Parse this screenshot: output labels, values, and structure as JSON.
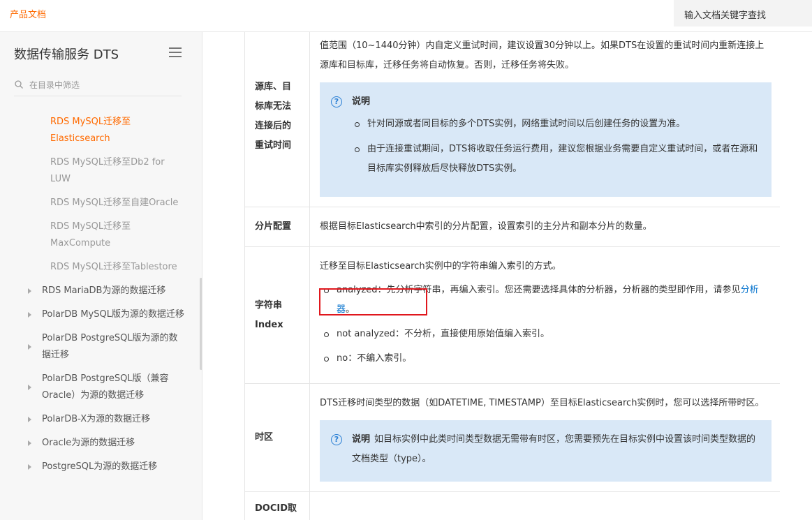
{
  "topbar": {
    "brand": "产品文档",
    "search_placeholder": "输入文档关键字查找"
  },
  "sidebar": {
    "title": "数据传输服务 DTS",
    "filter_placeholder": "在目录中筛选",
    "items": [
      {
        "label": "RDS MySQL迁移至Elasticsearch"
      },
      {
        "label": "RDS MySQL迁移至Db2 for LUW"
      },
      {
        "label": "RDS MySQL迁移至自建Oracle"
      },
      {
        "label": "RDS MySQL迁移至MaxCompute"
      },
      {
        "label": "RDS MySQL迁移至Tablestore"
      },
      {
        "label": "RDS MariaDB为源的数据迁移"
      },
      {
        "label": "PolarDB MySQL版为源的数据迁移"
      },
      {
        "label": "PolarDB PostgreSQL版为源的数据迁移"
      },
      {
        "label": "PolarDB PostgreSQL版（兼容Oracle）为源的数据迁移"
      },
      {
        "label": "PolarDB-X为源的数据迁移"
      },
      {
        "label": "Oracle为源的数据迁移"
      },
      {
        "label": "PostgreSQL为源的数据迁移"
      }
    ]
  },
  "content": {
    "rows": [
      {
        "name": "源库、目标库无法连接后的重试时间",
        "desc": "值范围（10~1440分钟）内自定义重试时间，建议设置30分钟以上。如果DTS在设置的重试时间内重新连接上源库和目标库，迁移任务将自动恢复。否则，迁移任务将失败。",
        "note_title": "说明",
        "note_items": [
          "针对同源或者同目标的多个DTS实例，网络重试时间以后创建任务的设置为准。",
          "由于连接重试期间，DTS将收取任务运行费用，建议您根据业务需要自定义重试时间，或者在源和目标库实例释放后尽快释放DTS实例。"
        ]
      },
      {
        "name": "分片配置",
        "desc": "根据目标Elasticsearch中索引的分片配置，设置索引的主分片和副本分片的数量。"
      },
      {
        "name": "字符串Index",
        "desc": "迁移至目标Elasticsearch实例中的字符串编入索引的方式。",
        "opt1": "analyzed：先分析字符串，再编入索引。您还需要选择具体的分析器，分析器的类型即作用，请参见",
        "opt1_link": "分析器",
        "opt1_end": "。",
        "opt2": "not analyzed：不分析，直接使用原始值编入索引。",
        "opt3": "no：不编入索引。"
      },
      {
        "name": "时区",
        "desc": "DTS迁移时间类型的数据（如DATETIME, TIMESTAMP）至目标Elasticsearch实例时，您可以选择所带时区。",
        "note_title": "说明",
        "note_text": "如目标实例中此类时间类型数据无需带有时区，您需要预先在目标实例中设置该时间类型数据的文档类型（type）。"
      },
      {
        "name": "DOCID取"
      }
    ]
  },
  "colors": {
    "accent": "#ff6a00",
    "link": "#0070cc",
    "note_bg": "#d9e8f7",
    "highlight_border": "#e0171d"
  }
}
